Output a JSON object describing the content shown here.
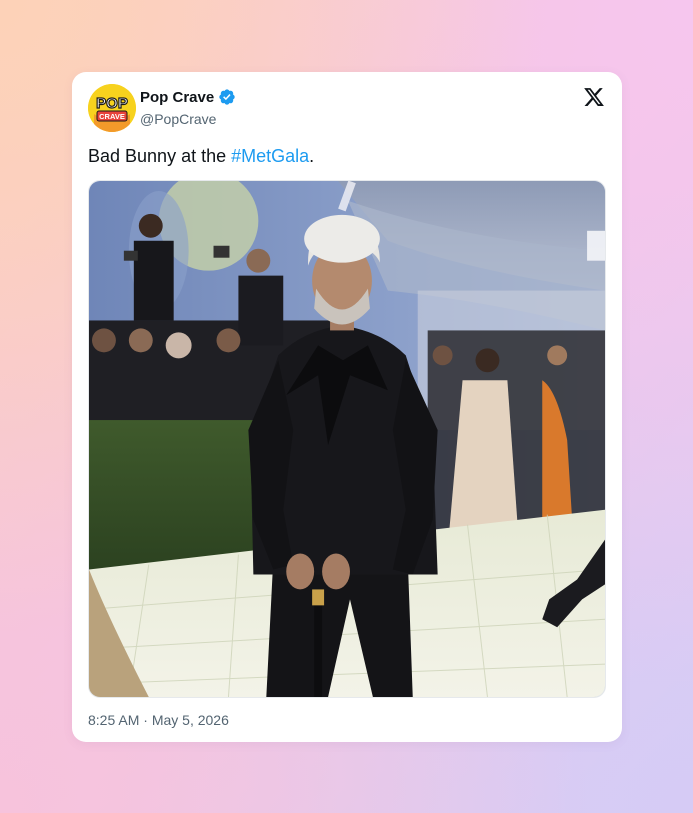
{
  "tweet": {
    "display_name": "Pop Crave",
    "handle": "@PopCrave",
    "verified": true,
    "avatar_text_top": "POP",
    "avatar_text_bottom": "CRAVE",
    "text_before": "Bad Bunny at the ",
    "hashtag": "#MetGala",
    "text_after": ".",
    "time": "8:25 AM",
    "separator": " · ",
    "date": "May 5, 2026"
  },
  "icons": {
    "verified": "verified-badge-icon",
    "platform": "x-logo-icon"
  },
  "colors": {
    "text": "#0f1419",
    "muted": "#536471",
    "link": "#1d9bf0",
    "verified": "#1d9bf0",
    "avatar_bg": "#f7d21e",
    "avatar_crave": "#e8423b"
  }
}
